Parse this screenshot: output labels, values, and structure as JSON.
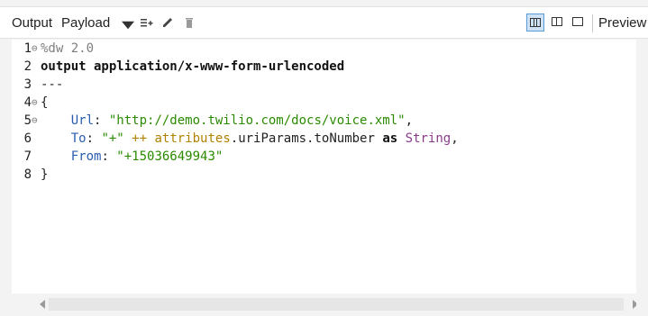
{
  "toolbar": {
    "output_label": "Output",
    "payload_label": "Payload",
    "preview_label": "Preview",
    "icons": {
      "caret": "chevron-down-icon",
      "add_lines": "add-lines-icon",
      "edit": "pencil-icon",
      "delete": "trash-icon"
    },
    "view_modes": [
      {
        "name": "text-view-icon",
        "active": true
      },
      {
        "name": "split-view-icon",
        "active": false
      },
      {
        "name": "single-view-icon",
        "active": false
      }
    ],
    "active_view_color": "#cfe3f7"
  },
  "editor": {
    "lines": [
      {
        "number": "1",
        "fold": "⊖",
        "segments": [
          {
            "cls": "cm",
            "text": "%dw 2.0"
          }
        ]
      },
      {
        "number": "2",
        "fold": "",
        "segments": [
          {
            "cls": "bold",
            "text": "output application/x-www-form-urlencoded"
          }
        ]
      },
      {
        "number": "3",
        "fold": "",
        "segments": [
          {
            "cls": "",
            "text": "---"
          }
        ]
      },
      {
        "number": "4",
        "fold": "⊖",
        "segments": [
          {
            "cls": "",
            "text": "{"
          }
        ]
      },
      {
        "number": "5",
        "fold": "⊖",
        "segments": [
          {
            "cls": "",
            "text": "    "
          },
          {
            "cls": "key",
            "text": "Url"
          },
          {
            "cls": "",
            "text": ": "
          },
          {
            "cls": "str",
            "text": "\"http://demo.twilio.com/docs/voice.xml\""
          },
          {
            "cls": "",
            "text": ","
          }
        ]
      },
      {
        "number": "6",
        "fold": "",
        "segments": [
          {
            "cls": "",
            "text": "    "
          },
          {
            "cls": "key",
            "text": "To"
          },
          {
            "cls": "",
            "text": ": "
          },
          {
            "cls": "str",
            "text": "\"+\""
          },
          {
            "cls": "",
            "text": " "
          },
          {
            "cls": "op",
            "text": "++"
          },
          {
            "cls": "",
            "text": " "
          },
          {
            "cls": "attr",
            "text": "attributes"
          },
          {
            "cls": "",
            "text": ".uriParams.toNumber "
          },
          {
            "cls": "kw",
            "text": "as"
          },
          {
            "cls": "",
            "text": " "
          },
          {
            "cls": "type",
            "text": "String"
          },
          {
            "cls": "",
            "text": ","
          }
        ]
      },
      {
        "number": "7",
        "fold": "",
        "segments": [
          {
            "cls": "",
            "text": "    "
          },
          {
            "cls": "key",
            "text": "From"
          },
          {
            "cls": "",
            "text": ": "
          },
          {
            "cls": "str",
            "text": "\"+15036649943\""
          }
        ]
      },
      {
        "number": "8",
        "fold": "",
        "segments": [
          {
            "cls": "",
            "text": "}"
          }
        ]
      }
    ]
  }
}
